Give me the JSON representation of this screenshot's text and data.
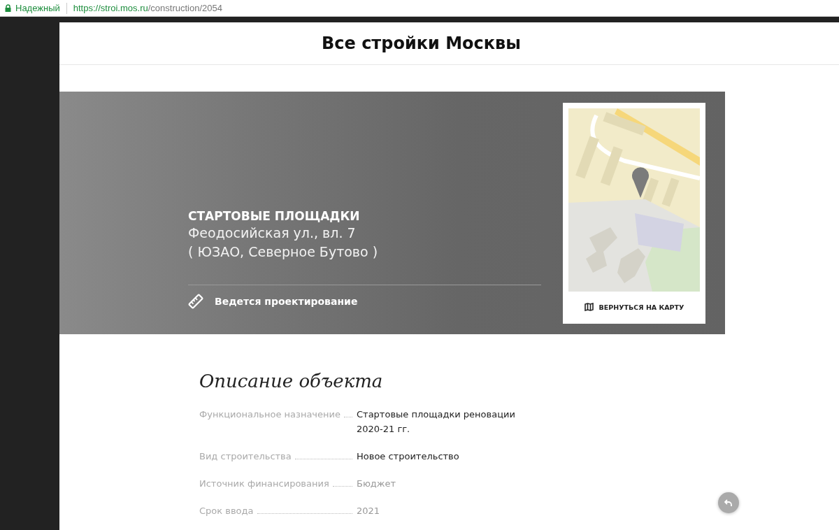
{
  "address_bar": {
    "security_label": "Надежный",
    "url_host": "https://stroi.mos.ru",
    "url_path": "/construction/2054"
  },
  "header": {
    "title": "Все стройки Москвы"
  },
  "banner": {
    "category": "СТАРТОВЫЕ ПЛОЩАДКИ",
    "address": "Феодосийская ул., вл. 7",
    "district": "( ЮЗАО, Северное Бутово )",
    "status": "Ведется проектирование",
    "map_link": "ВЕРНУТЬСЯ НА КАРТУ"
  },
  "description": {
    "title": "Описание объекта",
    "rows": [
      {
        "label": "Функциональное назначение",
        "value": "Стартовые площадки реновации 2020-21 гг.",
        "muted": false
      },
      {
        "label": "Вид строительства",
        "value": "Новое строительство",
        "muted": false
      },
      {
        "label": "Источник финансирования",
        "value": "Бюджет",
        "muted": true
      },
      {
        "label": "Срок ввода",
        "value": "2021",
        "muted": true
      }
    ]
  }
}
